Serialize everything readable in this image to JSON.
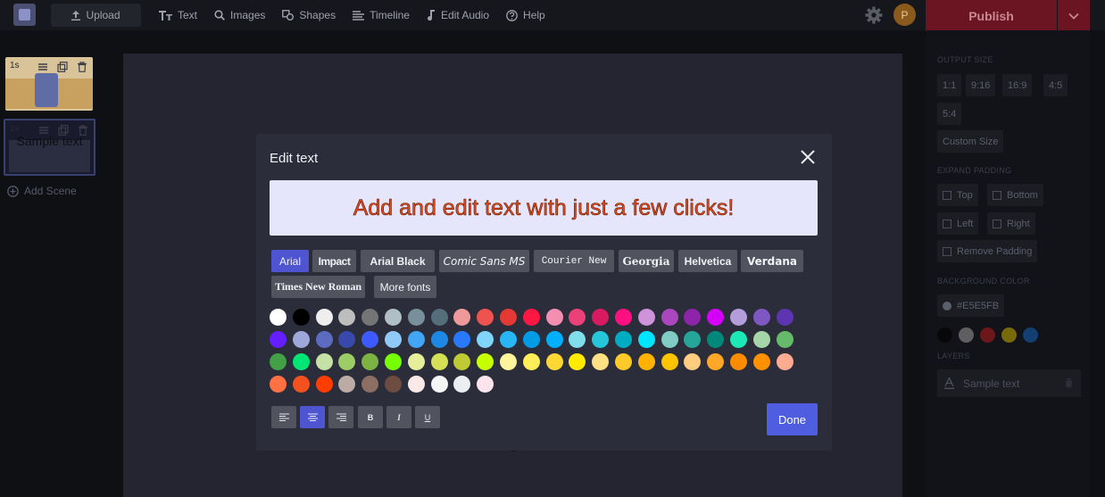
{
  "topbar": {
    "upload_label": "Upload",
    "nav": [
      {
        "label": "Text",
        "icon": "text-icon"
      },
      {
        "label": "Images",
        "icon": "search-icon"
      },
      {
        "label": "Shapes",
        "icon": "shapes-icon"
      },
      {
        "label": "Timeline",
        "icon": "timeline-icon"
      },
      {
        "label": "Edit Audio",
        "icon": "music-note-icon"
      },
      {
        "label": "Help",
        "icon": "help-icon"
      }
    ],
    "avatar_letter": "P",
    "publish_label": "Publish"
  },
  "scenes": {
    "items": [
      {
        "duration": "1s",
        "label": ""
      },
      {
        "duration": "1s",
        "label": "Sample text"
      }
    ],
    "add_label": "Add Scene"
  },
  "canvas": {
    "partial_text": "g"
  },
  "right_panel": {
    "output_size_title": "OUTPUT SIZE",
    "sizes": [
      "1:1",
      "9:16",
      "16:9",
      "4:5",
      "5:4"
    ],
    "custom_size_label": "Custom Size",
    "expand_padding_title": "EXPAND PADDING",
    "padding_options": [
      "Top",
      "Bottom",
      "Left",
      "Right",
      "Remove Padding"
    ],
    "background_color_title": "BACKGROUND COLOR",
    "background_color_value": "#E5E5FB",
    "bg_swatches": [
      "#000000",
      "#9e9e9e",
      "#b71c1c",
      "#c9b300",
      "#1565c0"
    ],
    "layers_title": "LAYERS",
    "layer_label": "Sample text"
  },
  "modal": {
    "title": "Edit text",
    "preview_text": "Add and edit text with just a few clicks!",
    "fonts": [
      "Arial",
      "Impact",
      "Arial Black",
      "Comic Sans MS",
      "Courier New",
      "Georgia",
      "Helvetica",
      "Verdana",
      "Times New Roman",
      "More fonts"
    ],
    "selected_font": "Arial",
    "colors": [
      "#ffffff",
      "#000000",
      "#eeeeee",
      "#bdbdbd",
      "#757575",
      "#b0bec5",
      "#78909c",
      "#546e7a",
      "#ef9a9a",
      "#ef5350",
      "#e53935",
      "#ff1744",
      "#f48fb1",
      "#ec407a",
      "#d81b60",
      "#ff1081",
      "#ce93d8",
      "#ab47bc",
      "#8e24aa",
      "#d500f9",
      "#b39ddb",
      "#7e57c2",
      "#5e35b1",
      "#651fff",
      "#9fa8da",
      "#5c6bc0",
      "#3949ab",
      "#3d5afe",
      "#90caf9",
      "#42a5f5",
      "#1e88e5",
      "#2979ff",
      "#81d4fa",
      "#29b6f6",
      "#039be5",
      "#00b0ff",
      "#80deea",
      "#26c6da",
      "#00acc1",
      "#00e5ff",
      "#80cbc4",
      "#26a69a",
      "#00897b",
      "#1de9b6",
      "#a5d6a7",
      "#66bb6a",
      "#43a047",
      "#00e676",
      "#c5e1a5",
      "#9ccc65",
      "#7cb342",
      "#76ff03",
      "#e6ee9c",
      "#d4e157",
      "#c0ca33",
      "#c6ff00",
      "#fff59d",
      "#ffee58",
      "#fdd835",
      "#ffea00",
      "#ffe082",
      "#ffca28",
      "#ffb300",
      "#ffc400",
      "#ffcc80",
      "#ffa726",
      "#fb8c00",
      "#ff9100",
      "#ffab91",
      "#ff7043",
      "#f4511e",
      "#ff3d00",
      "#bcaaa4",
      "#8d6e63",
      "#6d4c41",
      "#fbe9e7",
      "#f5f5f5",
      "#eceff1",
      "#fce4ec"
    ],
    "format_buttons": [
      {
        "icon": "align-left-icon",
        "label": ""
      },
      {
        "icon": "align-center-icon",
        "label": ""
      },
      {
        "icon": "align-right-icon",
        "label": ""
      },
      {
        "icon": "bold-icon",
        "label": "B"
      },
      {
        "icon": "italic-icon",
        "label": "I"
      },
      {
        "icon": "underline-icon",
        "label": "U"
      }
    ],
    "done_label": "Done"
  }
}
